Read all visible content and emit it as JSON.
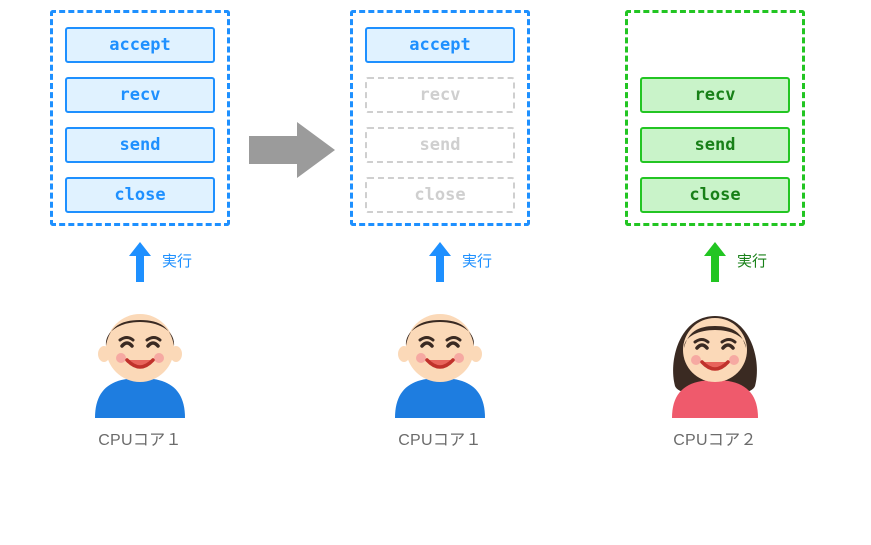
{
  "diagram": {
    "columns": [
      {
        "id": "before",
        "stack_style": "blue",
        "ops": [
          {
            "label": "accept",
            "style": "blue"
          },
          {
            "label": "recv",
            "style": "blue"
          },
          {
            "label": "send",
            "style": "blue"
          },
          {
            "label": "close",
            "style": "blue"
          }
        ],
        "exec_label": "実行",
        "exec_color": "blue",
        "person": "boy",
        "cpu_label": "CPUコア１"
      },
      {
        "id": "after-core1",
        "stack_style": "blue",
        "ops": [
          {
            "label": "accept",
            "style": "blue"
          },
          {
            "label": "recv",
            "style": "faded"
          },
          {
            "label": "send",
            "style": "faded"
          },
          {
            "label": "close",
            "style": "faded"
          }
        ],
        "exec_label": "実行",
        "exec_color": "blue",
        "person": "boy",
        "cpu_label": "CPUコア１"
      },
      {
        "id": "after-core2",
        "stack_style": "green",
        "ops": [
          {
            "label": "",
            "style": "gap"
          },
          {
            "label": "recv",
            "style": "green"
          },
          {
            "label": "send",
            "style": "green"
          },
          {
            "label": "close",
            "style": "green"
          }
        ],
        "exec_label": "実行",
        "exec_color": "green",
        "person": "girl",
        "cpu_label": "CPUコア２"
      }
    ],
    "transition_arrow": true
  }
}
